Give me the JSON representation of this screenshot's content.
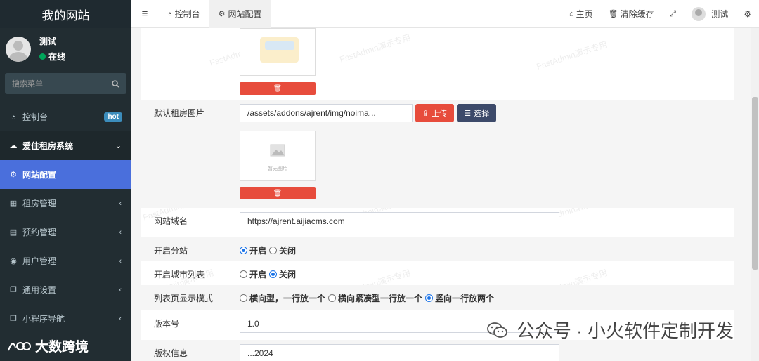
{
  "sidebar": {
    "title": "我的网站",
    "user": {
      "name": "测试",
      "status": "在线"
    },
    "search_placeholder": "搜索菜单",
    "items": [
      {
        "label": "控制台",
        "icon": "dashboard-icon",
        "badge": "hot"
      },
      {
        "label": "爱佳租房系统",
        "icon": "cloud-icon"
      },
      {
        "label": "网站配置",
        "icon": "cogs-icon"
      },
      {
        "label": "租房管理",
        "icon": "grid-icon"
      },
      {
        "label": "预约管理",
        "icon": "list-alt-icon"
      },
      {
        "label": "用户管理",
        "icon": "user-circle-icon"
      },
      {
        "label": "通用设置",
        "icon": "copy-icon"
      },
      {
        "label": "小程序导航",
        "icon": "copy-icon"
      }
    ],
    "brand": "大数跨境"
  },
  "topnav": {
    "tabs": [
      {
        "label": "控制台",
        "icon": "dashboard-icon"
      },
      {
        "label": "网站配置",
        "icon": "cogs-icon"
      }
    ],
    "right": {
      "home": "主页",
      "clear_cache": "清除缓存",
      "user": "测试"
    }
  },
  "form": {
    "default_image": {
      "label": "默认租房图片",
      "value": "/assets/addons/ajrent/img/noima...",
      "upload": "上传",
      "choose": "选择",
      "no_image_text": "暂无图片"
    },
    "domain": {
      "label": "网站域名",
      "value": "https://ajrent.aijiacms.com"
    },
    "substation": {
      "label": "开启分站",
      "options": [
        "开启",
        "关闭"
      ],
      "selected": 0
    },
    "city_list": {
      "label": "开启城市列表",
      "options": [
        "开启",
        "关闭"
      ],
      "selected": 1
    },
    "list_mode": {
      "label": "列表页显示模式",
      "options": [
        "横向型，一行放一个",
        "横向紧凑型一行放一个",
        "竖向一行放两个"
      ],
      "selected": 2
    },
    "version": {
      "label": "版本号",
      "value": "1.0"
    },
    "copyright": {
      "label": "版权信息",
      "value": "...2024"
    }
  },
  "watermark": "FastAdmin演示专用",
  "wechat_footer": "公众号 · 小火软件定制开发"
}
